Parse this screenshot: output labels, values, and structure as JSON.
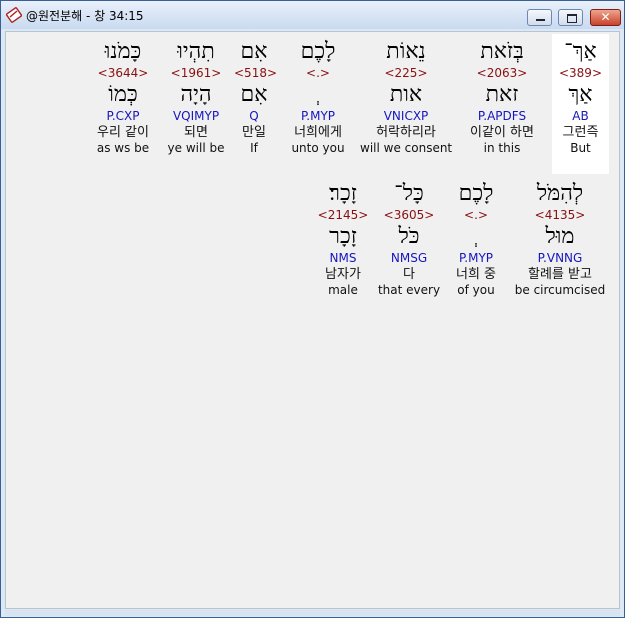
{
  "window": {
    "title": "@원전분해 - 창 34:15",
    "close_glyph": "✕"
  },
  "colors": {
    "strong": "#8a1010",
    "parse": "#1515c0",
    "selected_bg": "#ffffff"
  },
  "rows": [
    {
      "words": [
        {
          "heb": "כָּמֹנוּ",
          "strong": "<3644>",
          "root": "כְּמוֹ",
          "parse": "P.CXP",
          "kor": "우리 같이",
          "eng": "as ws be"
        },
        {
          "heb": "תִהְיוּ",
          "strong": "<1961>",
          "root": "הָיָה",
          "parse": "VQIMYP",
          "kor": "되면",
          "eng": "ye will be"
        },
        {
          "heb": "אִם",
          "strong": "<518>",
          "root": "אִם",
          "parse": "Q",
          "kor": "만일",
          "eng": "If"
        },
        {
          "heb": "לָכֶם",
          "strong": "<.>",
          "root": "ְ",
          "parse": "P.MYP",
          "kor": "너희에게",
          "eng": "unto you"
        },
        {
          "heb": "נֵאוֹת",
          "strong": "<225>",
          "root": "אות",
          "parse": "VNICXP",
          "kor": "허락하리라",
          "eng": "will we consent"
        },
        {
          "heb": "בְּזֹאת",
          "strong": "<2063>",
          "root": "זאת",
          "parse": "P.APDFS",
          "kor": "이같이 하면",
          "eng": "in this"
        },
        {
          "heb": "אַךְ־",
          "strong": "<389>",
          "root": "אַךְ",
          "parse": "AB",
          "kor": "그런즉",
          "eng": "But"
        }
      ]
    },
    {
      "words": [
        {
          "heb": "זָכָר׃",
          "strong": "<2145>",
          "root": "זָכָר",
          "parse": "NMS",
          "kor": "남자가",
          "eng": "male"
        },
        {
          "heb": "כָּל־",
          "strong": "<3605>",
          "root": "כֹּל",
          "parse": "NMSG",
          "kor": "다",
          "eng": "that every"
        },
        {
          "heb": "לָכֶם",
          "strong": "<.>",
          "root": "ְ",
          "parse": "P.MYP",
          "kor": "너희 중",
          "eng": "of you"
        },
        {
          "heb": "לְהִמֹּל",
          "strong": "<4135>",
          "root": "מוּל",
          "parse": "P.VNNG",
          "kor": "할례를 받고",
          "eng": "be circumcised"
        }
      ]
    }
  ]
}
